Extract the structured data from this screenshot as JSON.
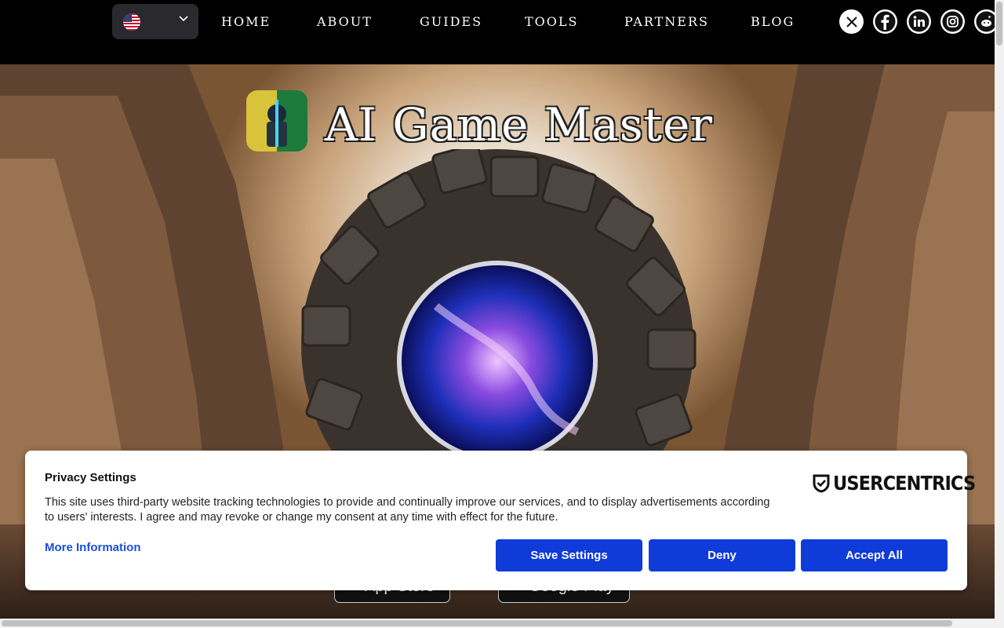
{
  "nav": {
    "language": {
      "selected": "English (US)",
      "flag_icon": "us-flag-icon",
      "chevron_icon": "chevron-down-icon"
    },
    "items": [
      {
        "label": "HOME"
      },
      {
        "label": "ABOUT"
      },
      {
        "label": "GUIDES"
      },
      {
        "label": "TOOLS"
      },
      {
        "label": "PARTNERS"
      },
      {
        "label": "BLOG"
      }
    ],
    "social": [
      "x-icon",
      "facebook-icon",
      "linkedin-icon",
      "instagram-icon",
      "reddit-icon"
    ]
  },
  "hero": {
    "title": "AI Game Master",
    "app_store_label": "App Store",
    "google_play_label": "Google Play"
  },
  "consent": {
    "title": "Privacy Settings",
    "description": "This site uses third-party website tracking technologies to provide and continually improve our services, and to display advertisements according to users' interests. I agree and may revoke or change my consent at any time with effect for the future.",
    "more_info": "More Information",
    "brand": "USERCENTRICS",
    "buttons": {
      "save": "Save Settings",
      "deny": "Deny",
      "accept": "Accept All"
    },
    "button_color": "#0f3bd9",
    "link_color": "#1a4fd8"
  }
}
